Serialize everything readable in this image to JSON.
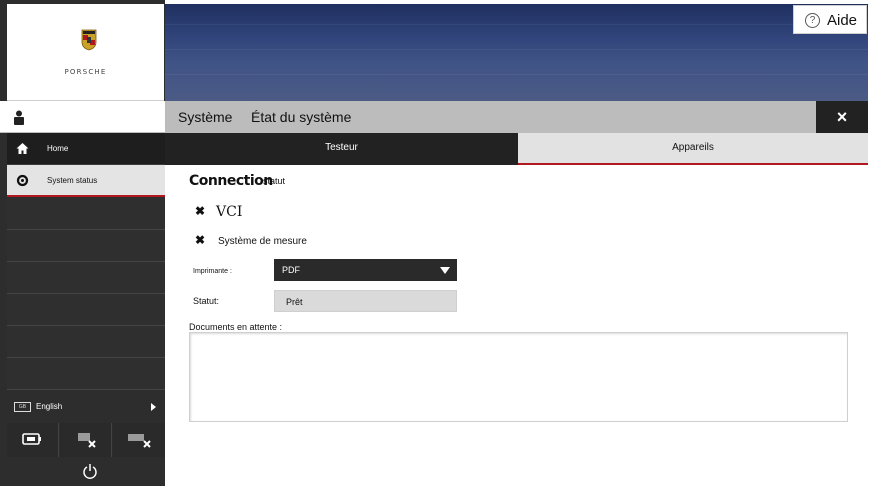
{
  "brand": {
    "name": "PORSCHE"
  },
  "help": {
    "label": "Aide",
    "icon": "help-circle-icon"
  },
  "titlebar": {
    "section": "Système",
    "page": "État du système",
    "close": "×"
  },
  "tabs": [
    {
      "label": "Testeur",
      "active": true
    },
    {
      "label": "Appareils",
      "active": false
    }
  ],
  "sidebar": {
    "items": [
      {
        "label": "Home",
        "icon": "home-icon"
      },
      {
        "label": "System status",
        "icon": "gear-icon"
      }
    ],
    "language": {
      "label": "English",
      "icon": "keyboard-icon"
    }
  },
  "connection": {
    "title": "Connection",
    "subtitle": "statut",
    "vci": {
      "label": "VCI",
      "icon": "x-mark-icon"
    },
    "mesure": {
      "label": "Système de mesure",
      "icon": "x-mark-icon"
    }
  },
  "printer": {
    "label": "Imprimante :",
    "value": "PDF"
  },
  "status": {
    "label": "Statut:",
    "value": "Prêt"
  },
  "documents": {
    "label": "Documents en attente :",
    "value": ""
  },
  "colors": {
    "accent_red": "#b0171f",
    "dark": "#222222",
    "banner": "#31457c"
  }
}
